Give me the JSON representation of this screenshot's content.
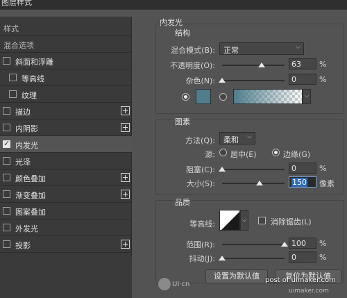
{
  "window": {
    "title": "图层样式"
  },
  "sidebar": {
    "header_styles": "样式",
    "header_blend": "混合选项",
    "items": [
      {
        "label": "斜面和浮雕",
        "checked": false,
        "plus": false,
        "indent": false
      },
      {
        "label": "等高线",
        "checked": false,
        "plus": false,
        "indent": true
      },
      {
        "label": "纹理",
        "checked": false,
        "plus": false,
        "indent": true
      },
      {
        "label": "描边",
        "checked": false,
        "plus": true,
        "indent": false
      },
      {
        "label": "内阴影",
        "checked": false,
        "plus": true,
        "indent": false
      },
      {
        "label": "内发光",
        "checked": true,
        "plus": false,
        "indent": false
      },
      {
        "label": "光泽",
        "checked": false,
        "plus": false,
        "indent": false
      },
      {
        "label": "颜色叠加",
        "checked": false,
        "plus": true,
        "indent": false
      },
      {
        "label": "渐变叠加",
        "checked": false,
        "plus": true,
        "indent": false
      },
      {
        "label": "图案叠加",
        "checked": false,
        "plus": false,
        "indent": false
      },
      {
        "label": "外发光",
        "checked": false,
        "plus": false,
        "indent": false
      },
      {
        "label": "投影",
        "checked": false,
        "plus": true,
        "indent": false
      }
    ]
  },
  "inner_glow": {
    "title": "内发光",
    "structure": {
      "title": "结构",
      "blend_mode_label": "混合模式(B):",
      "blend_mode_value": "正常",
      "opacity_label": "不透明度(O):",
      "opacity_value": "63",
      "opacity_fraction": 0.63,
      "noise_label": "杂色(N):",
      "noise_value": "0",
      "noise_fraction": 0.0,
      "unit": "%",
      "glow_color": "#4f7d8c",
      "gradient_color": "#4f7d8c"
    },
    "elements": {
      "title": "图素",
      "technique_label": "方法(Q):",
      "technique_value": "柔和",
      "source_label": "源:",
      "source_center": "居中(E)",
      "source_edge": "边缘(G)",
      "choke_label": "阻塞(C):",
      "choke_value": "0",
      "choke_fraction": 0.0,
      "size_label": "大小(S):",
      "size_value": "150",
      "size_fraction": 0.6,
      "size_unit": "像素",
      "unit": "%"
    },
    "quality": {
      "title": "品质",
      "contour_label": "等高线:",
      "antialias_label": "消除锯齿(L)",
      "range_label": "范围(R):",
      "range_value": "100",
      "range_fraction": 1.0,
      "jitter_label": "抖动(J):",
      "jitter_value": "0",
      "jitter_fraction": 0.0,
      "unit": "%"
    },
    "buttons": {
      "set_default": "设置为默认值",
      "reset_default": "复位为默认值"
    }
  },
  "watermark": {
    "left": "UI·cn",
    "right_top": "post of uimaker.com",
    "right_bottom": "uimaker.com"
  }
}
